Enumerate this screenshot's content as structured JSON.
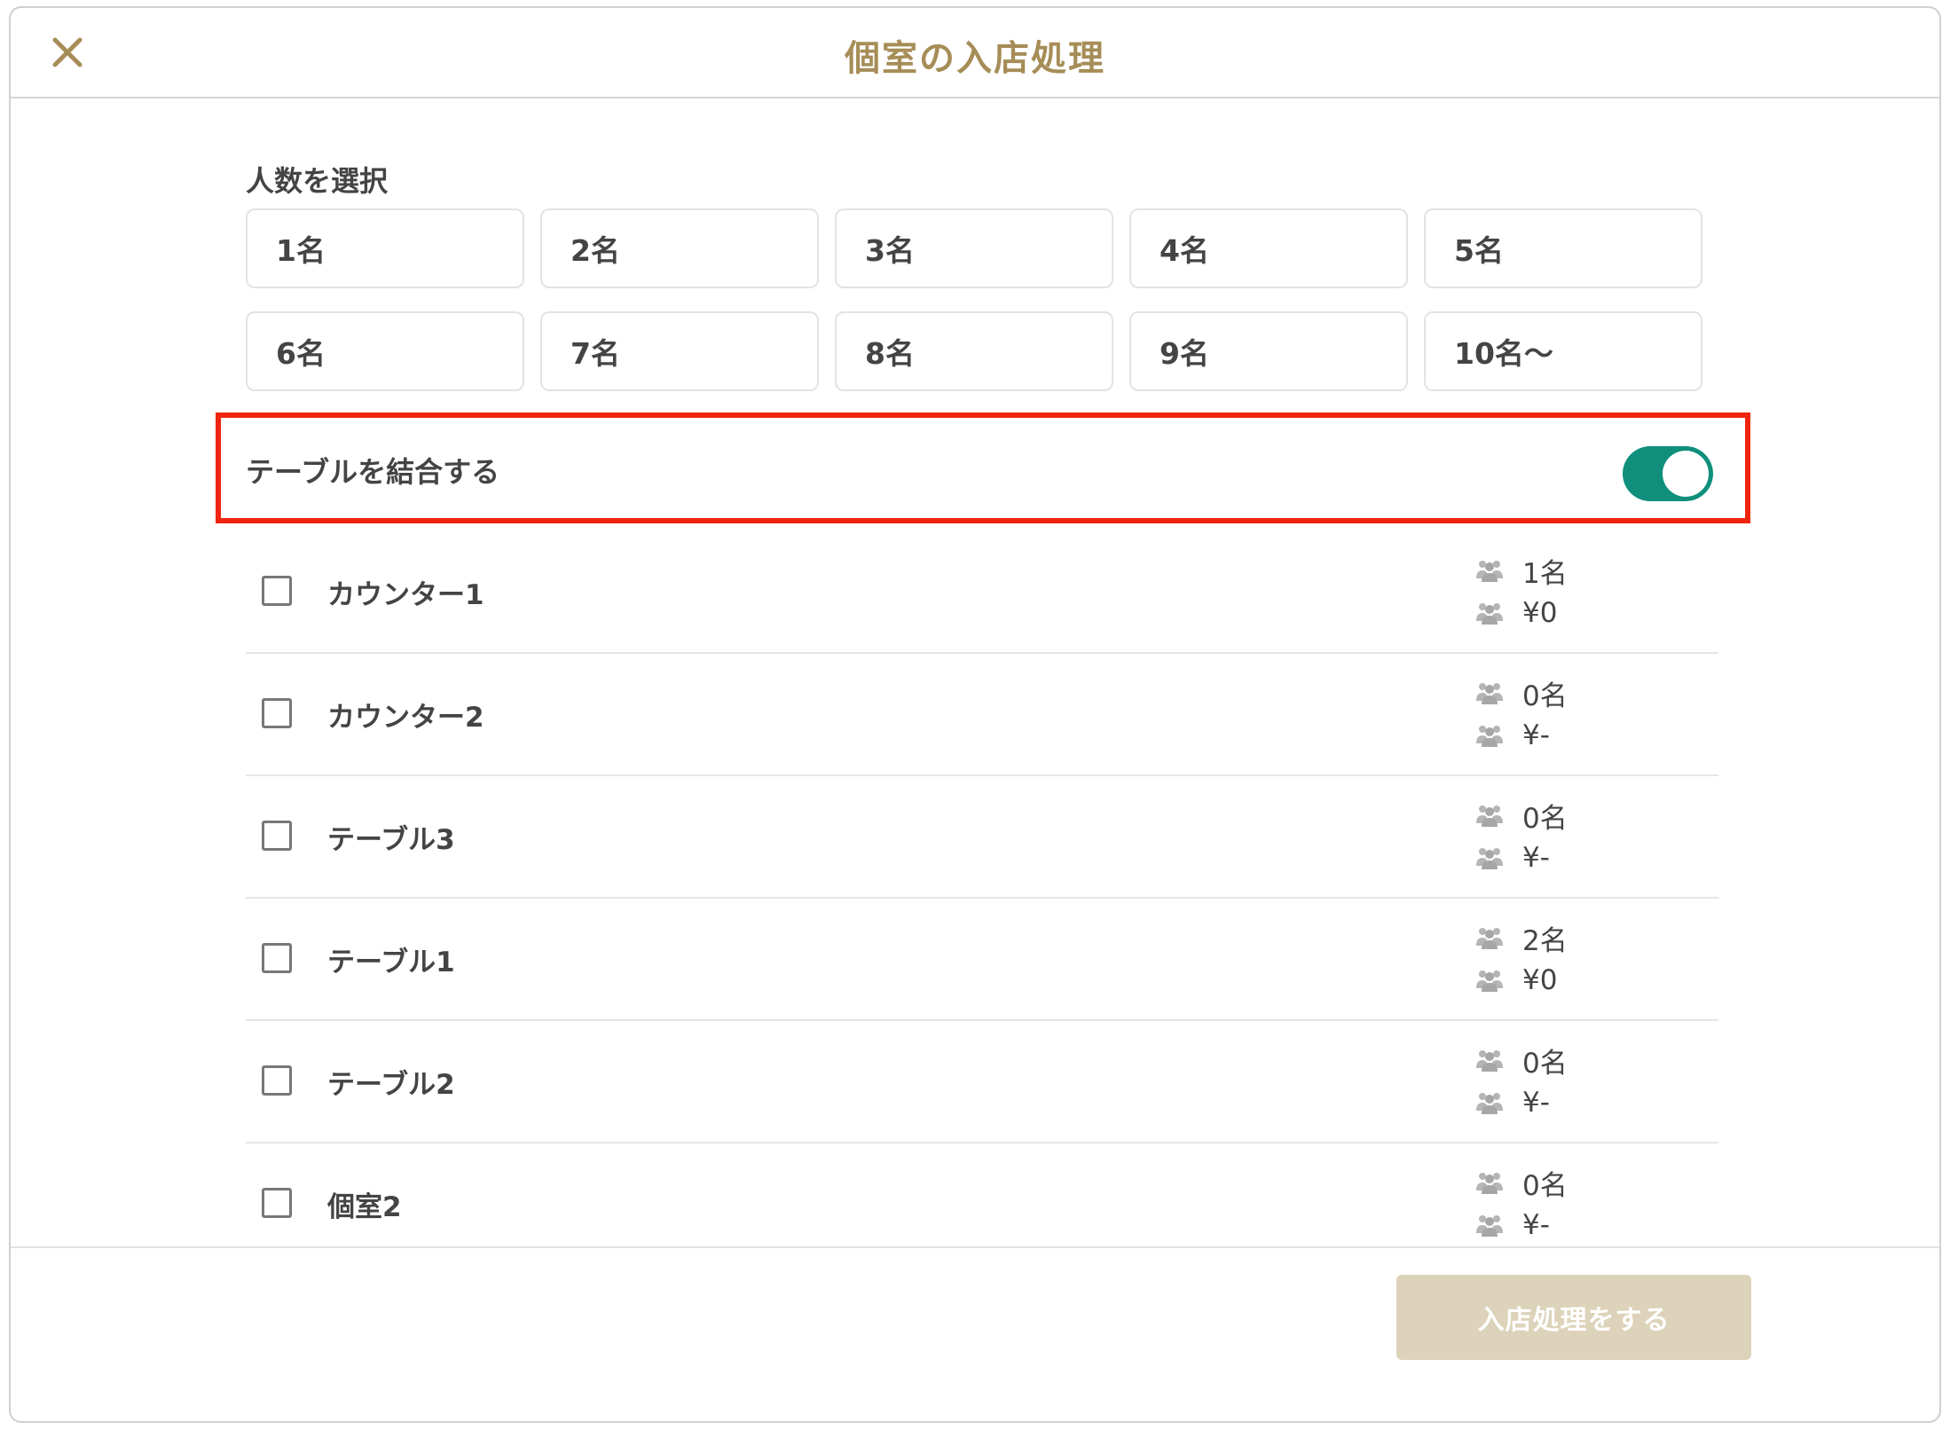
{
  "header": {
    "title": "個室の入店処理"
  },
  "people": {
    "label": "人数を選択",
    "options": [
      "1名",
      "2名",
      "3名",
      "4名",
      "5名",
      "6名",
      "7名",
      "8名",
      "9名",
      "10名〜"
    ]
  },
  "combine": {
    "label": "テーブルを結合する",
    "enabled": true
  },
  "tables": [
    {
      "name": "カウンター1",
      "guests": "1名",
      "amount": "¥0"
    },
    {
      "name": "カウンター2",
      "guests": "0名",
      "amount": "¥-"
    },
    {
      "name": "テーブル3",
      "guests": "0名",
      "amount": "¥-"
    },
    {
      "name": "テーブル1",
      "guests": "2名",
      "amount": "¥0"
    },
    {
      "name": "テーブル2",
      "guests": "0名",
      "amount": "¥-"
    },
    {
      "name": "個室2",
      "guests": "0名",
      "amount": "¥-"
    }
  ],
  "footer": {
    "submit_label": "入店処理をする"
  },
  "colors": {
    "accent": "#a68d57",
    "toggle_on": "#0f8f7c",
    "highlight": "#f0240f",
    "submit_disabled": "#ddd3ba"
  },
  "icons": {
    "close": "close-icon",
    "people": "people-icon"
  }
}
